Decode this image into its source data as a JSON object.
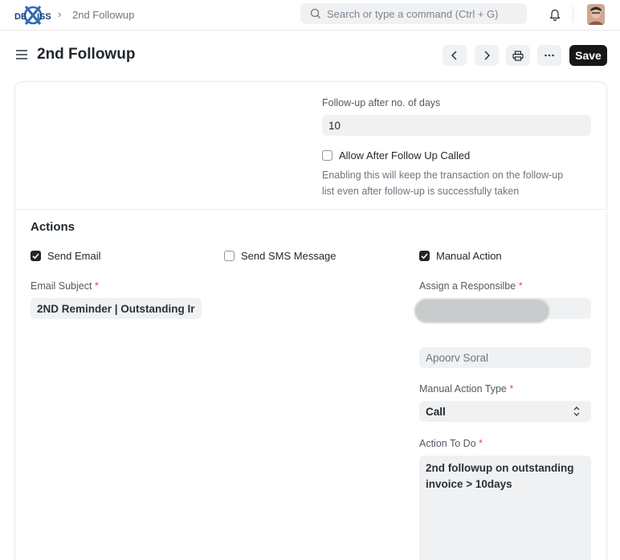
{
  "navbar": {
    "logo_text": "DEXCISS",
    "breadcrumb": "2nd Followup",
    "search_placeholder": "Search or type a command (Ctrl + G)",
    "icons": [
      "search-icon",
      "bell-icon",
      "avatar"
    ]
  },
  "header": {
    "title": "2nd Followup",
    "save_label": "Save",
    "icons": [
      "menu-icon",
      "prev-icon",
      "next-icon",
      "print-icon",
      "more-icon"
    ]
  },
  "form": {
    "followup_days": {
      "label": "Follow-up after no. of days",
      "value": "10"
    },
    "allow_after": {
      "label": "Allow After Follow Up Called",
      "checked": false,
      "description_line1": "Enabling this will keep the transaction on the follow-up",
      "description_line2": "list even after follow-up is successfully taken"
    },
    "actions": {
      "section_title": "Actions",
      "send_email": {
        "label": "Send Email",
        "checked": true
      },
      "send_sms": {
        "label": "Send SMS Message",
        "checked": false
      },
      "manual_action": {
        "label": "Manual Action",
        "checked": true
      },
      "email_subject": {
        "label": "Email Subject",
        "required_mark": "*",
        "value": "2ND Reminder | Outstanding Ir"
      },
      "assign_responsible": {
        "label": "Assign a Responsilbe",
        "required_mark": "*",
        "value": ""
      },
      "responsible_name": {
        "value": "Apoorv Soral"
      },
      "manual_action_type": {
        "label": "Manual Action Type",
        "required_mark": "*",
        "value": "Call"
      },
      "action_to_do": {
        "label": "Action To Do",
        "required_mark": "*",
        "value_line1": "2nd followup on outstanding",
        "value_line2": "invoice > 10days"
      }
    }
  },
  "colors": {
    "primary_button": "#171717",
    "field_bg": "#f0f1f2",
    "required": "#e24c4c"
  }
}
